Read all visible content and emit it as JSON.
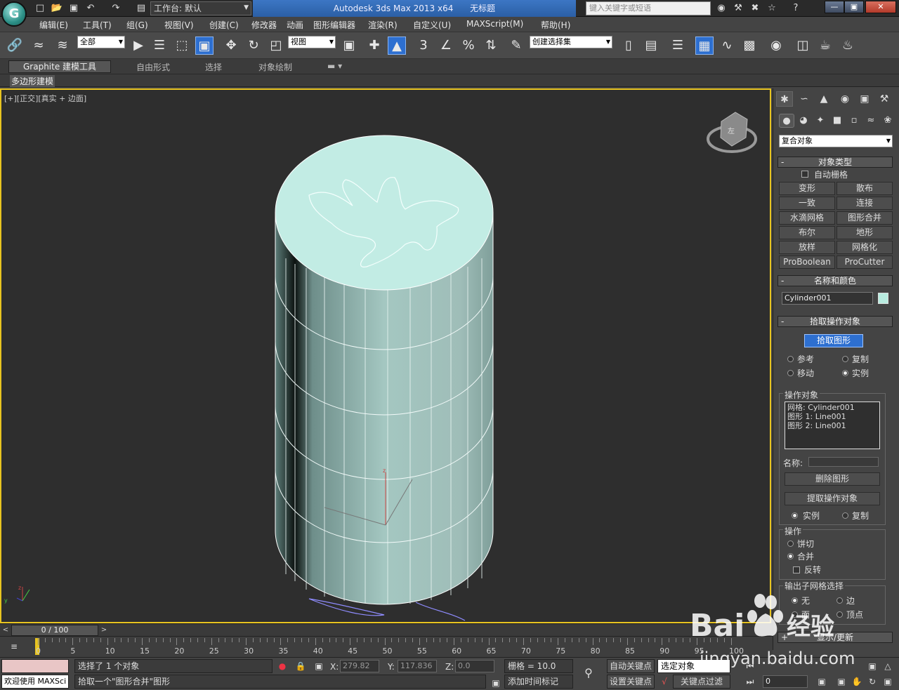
{
  "titlebar": {
    "workspace": "工作台: 默认",
    "app_title": "Autodesk 3ds Max  2013 x64",
    "doc_title": "无标题",
    "search_placeholder": "键入关键字或短语"
  },
  "menu": [
    "编辑(E)",
    "工具(T)",
    "组(G)",
    "视图(V)",
    "创建(C)",
    "修改器",
    "动画",
    "图形编辑器",
    "渲染(R)",
    "自定义(U)",
    "MAXScript(M)",
    "帮助(H)"
  ],
  "toolbar": {
    "selection_filter": "全部",
    "ref_coord": "视图",
    "named_selection": "创建选择集",
    "snap_3d": "3"
  },
  "ribbon": {
    "tabs": [
      "Graphite 建模工具",
      "自由形式",
      "选择",
      "对象绘制"
    ],
    "subtab": "多边形建模"
  },
  "viewport": {
    "label": "[+][正交][真实 + 边面]",
    "cube_label": "左"
  },
  "command_panel": {
    "category": "复合对象",
    "object_type": {
      "title": "对象类型",
      "auto_grid": "自动栅格",
      "buttons": [
        "变形",
        "散布",
        "一致",
        "连接",
        "水滴网格",
        "图形合并",
        "布尔",
        "地形",
        "放样",
        "网格化",
        "ProBoolean",
        "ProCutter"
      ]
    },
    "name_color": {
      "title": "名称和颜色",
      "object_name": "Cylinder001",
      "color": "#b8ece0"
    },
    "pick_operand": {
      "title": "拾取操作对象",
      "pick_button": "拾取图形",
      "options": [
        "参考",
        "复制",
        "移动",
        "实例"
      ],
      "selected": "实例"
    },
    "operands": {
      "title": "操作对象",
      "items": [
        "网格: Cylinder001",
        "图形 1: Line001",
        "图形 2: Line001"
      ],
      "name_label": "名称:",
      "delete_button": "删除图形",
      "extract_button": "提取操作对象",
      "instance_label": "实例",
      "copy_label": "复制"
    },
    "operation": {
      "title": "操作",
      "options": [
        "饼切",
        "合并"
      ],
      "selected": "合并",
      "invert_label": "反转"
    },
    "output_subselect": {
      "title": "输出子网格选择",
      "options": [
        "无",
        "边",
        "面",
        "顶点"
      ],
      "selected": "无"
    },
    "update_label": "显示/更新"
  },
  "timeline": {
    "slider_text": "0 / 100",
    "ticks": [
      "0",
      "5",
      "10",
      "15",
      "20",
      "25",
      "30",
      "35",
      "40",
      "45",
      "50",
      "55",
      "60",
      "65",
      "70",
      "75",
      "80",
      "85",
      "90",
      "95",
      "100"
    ]
  },
  "status": {
    "welcome": "欢迎使用 MAXSci",
    "selection_info": "选择了 1 个对象",
    "prompt": "拾取一个\"图形合并\"图形",
    "x_label": "X:",
    "x_value": "279.82",
    "y_label": "Y:",
    "y_value": "117.836",
    "z_label": "Z:",
    "z_value": "0.0",
    "grid": "栅格 = 10.0",
    "add_time_tag": "添加时间标记",
    "auto_key": "自动关键点",
    "set_key": "设置关键点",
    "key_mode": "选定对象",
    "key_filters": "关键点过滤器...",
    "frame": "0"
  },
  "watermark": {
    "brand": "Bai",
    "brand_cn": "经验",
    "url": "jingyan.baidu.com"
  }
}
